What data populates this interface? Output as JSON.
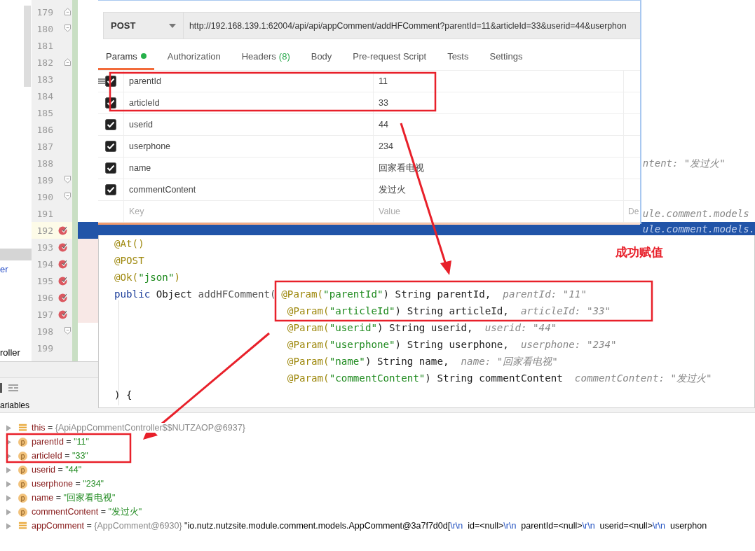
{
  "project_panel": {
    "items": [
      {
        "text": "er",
        "kind": "link"
      },
      {
        "text": "roller",
        "kind": "plain"
      }
    ]
  },
  "gutter": {
    "lines": [
      {
        "number": "179",
        "kind": "fold-end",
        "breakpoint": false,
        "current": false
      },
      {
        "number": "180",
        "kind": "fold-start",
        "breakpoint": false,
        "current": false
      },
      {
        "number": "181",
        "kind": "plain",
        "breakpoint": false,
        "current": false
      },
      {
        "number": "182",
        "kind": "fold-end",
        "breakpoint": false,
        "current": false
      },
      {
        "number": "183",
        "kind": "plain",
        "breakpoint": false,
        "current": false
      },
      {
        "number": "184",
        "kind": "plain",
        "breakpoint": false,
        "current": false
      },
      {
        "number": "185",
        "kind": "plain",
        "breakpoint": false,
        "current": false
      },
      {
        "number": "186",
        "kind": "plain",
        "breakpoint": false,
        "current": false
      },
      {
        "number": "187",
        "kind": "plain",
        "breakpoint": false,
        "current": false
      },
      {
        "number": "188",
        "kind": "plain",
        "breakpoint": false,
        "current": false,
        "code_fragment": "ntent: \"发过火\""
      },
      {
        "number": "189",
        "kind": "fold-start",
        "breakpoint": false,
        "current": false
      },
      {
        "number": "190",
        "kind": "fold-start",
        "breakpoint": false,
        "current": false
      },
      {
        "number": "191",
        "kind": "plain",
        "breakpoint": false,
        "current": false,
        "code_fragment": "ule.comment.models"
      },
      {
        "number": "192",
        "kind": "plain",
        "breakpoint": true,
        "current": true,
        "code_fragment": "ule.comment.models."
      },
      {
        "number": "193",
        "kind": "plain",
        "breakpoint": true,
        "current": false
      },
      {
        "number": "194",
        "kind": "plain",
        "breakpoint": true,
        "current": false
      },
      {
        "number": "195",
        "kind": "plain",
        "breakpoint": true,
        "current": false
      },
      {
        "number": "196",
        "kind": "plain",
        "breakpoint": true,
        "current": false
      },
      {
        "number": "197",
        "kind": "plain",
        "breakpoint": true,
        "current": false
      },
      {
        "number": "198",
        "kind": "fold-start",
        "breakpoint": false,
        "current": false
      },
      {
        "number": "199",
        "kind": "plain",
        "breakpoint": false,
        "current": false
      }
    ]
  },
  "debugger": {
    "tab": "ariables",
    "variables": [
      {
        "kind": "field",
        "name": "this",
        "sep": "=",
        "parts": [
          {
            "text": "{ApiAppCommentController$$NUTZAOP@6937}",
            "kind": "ref"
          }
        ]
      },
      {
        "kind": "param",
        "badge": "p",
        "name": "parentId",
        "sep": "=",
        "parts": [
          {
            "text": "\"11\"",
            "kind": "string"
          }
        ]
      },
      {
        "kind": "param",
        "badge": "p",
        "name": "articleId",
        "sep": "=",
        "parts": [
          {
            "text": "\"33\"",
            "kind": "string"
          }
        ]
      },
      {
        "kind": "param",
        "badge": "p",
        "name": "userid",
        "sep": "=",
        "parts": [
          {
            "text": "\"44\"",
            "kind": "string"
          }
        ]
      },
      {
        "kind": "param",
        "badge": "p",
        "name": "userphone",
        "sep": "=",
        "parts": [
          {
            "text": "\"234\"",
            "kind": "string"
          }
        ]
      },
      {
        "kind": "param",
        "badge": "p",
        "name": "name",
        "sep": "=",
        "parts": [
          {
            "text": "\"回家看电视\"",
            "kind": "string"
          }
        ]
      },
      {
        "kind": "param",
        "badge": "p",
        "name": "commentContent",
        "sep": "=",
        "parts": [
          {
            "text": "\"发过火\"",
            "kind": "string"
          }
        ]
      },
      {
        "kind": "field",
        "name": "appComment",
        "sep": "=",
        "parts": [
          {
            "text": "{AppComment@6930}",
            "kind": "ref"
          },
          {
            "text": " \"io.nutz.nutzsite.module.comment.models.AppComment@3a7f7d0d[",
            "kind": "plain"
          },
          {
            "text": "\\r\\n",
            "kind": "escape"
          },
          {
            "text": "  id=<null>",
            "kind": "plain"
          },
          {
            "text": "\\r\\n",
            "kind": "escape"
          },
          {
            "text": "  parentId=<null>",
            "kind": "plain"
          },
          {
            "text": "\\r\\n",
            "kind": "escape"
          },
          {
            "text": "  userid=<null>",
            "kind": "plain"
          },
          {
            "text": "\\r\\n",
            "kind": "escape"
          },
          {
            "text": "  userphon",
            "kind": "plain"
          }
        ]
      }
    ]
  },
  "postman": {
    "method": "POST",
    "url": "http://192.168.139.1:62004/api/api/appComment/addHFComment?parentId=11&articleId=33&userid=44&userphon",
    "tabs": [
      {
        "label": "Params",
        "selected": true,
        "dot": true
      },
      {
        "label": "Authorization",
        "selected": false,
        "dot": false
      },
      {
        "label": "Headers",
        "badge": "(8)",
        "selected": false,
        "dot": false
      },
      {
        "label": "Body",
        "selected": false,
        "dot": false
      },
      {
        "label": "Pre-request Script",
        "selected": false,
        "dot": false
      },
      {
        "label": "Tests",
        "selected": false,
        "dot": false
      },
      {
        "label": "Settings",
        "selected": false,
        "dot": false
      }
    ],
    "params": [
      {
        "key": "parentId",
        "value": "11",
        "checked": true
      },
      {
        "key": "articleId",
        "value": "33",
        "checked": true
      },
      {
        "key": "userid",
        "value": "44",
        "checked": true
      },
      {
        "key": "userphone",
        "value": "234",
        "checked": true
      },
      {
        "key": "name",
        "value": "回家看电视",
        "checked": true
      },
      {
        "key": "commentContent",
        "value": "发过火",
        "checked": true
      }
    ],
    "new_row": {
      "key_placeholder": "Key",
      "value_placeholder": "Value",
      "column_3_placeholder": "De"
    }
  },
  "code_popup": {
    "annotations": [
      "@At()",
      "@POST"
    ],
    "ok_line": {
      "annotation": "@Ok(",
      "arg": "\"json\"",
      "close": ")"
    },
    "signature": {
      "keyword": "public",
      "type": "Object",
      "method": "addHFComment("
    },
    "params": [
      {
        "annotation": "@Param(",
        "key": "\"parentId\"",
        "rest": ") String parentId,",
        "hint": "parentId: \"11\""
      },
      {
        "annotation": "@Param(",
        "key": "\"articleId\"",
        "rest": ") String articleId,",
        "hint": "articleId: \"33\""
      },
      {
        "annotation": "@Param(",
        "key": "\"userid\"",
        "rest": ") String userid,",
        "hint": "userid: \"44\""
      },
      {
        "annotation": "@Param(",
        "key": "\"userphone\"",
        "rest": ") String userphone,",
        "hint": "userphone: \"234\""
      },
      {
        "annotation": "@Param(",
        "key": "\"name\"",
        "rest": ") String name,",
        "hint": "name: \"回家看电视\""
      },
      {
        "annotation": "@Param(",
        "key": "\"commentContent\"",
        "rest": ") String commentContent",
        "hint": "commentContent: \"发过火\""
      }
    ],
    "closing": ") {",
    "callout": "成功赋值"
  }
}
